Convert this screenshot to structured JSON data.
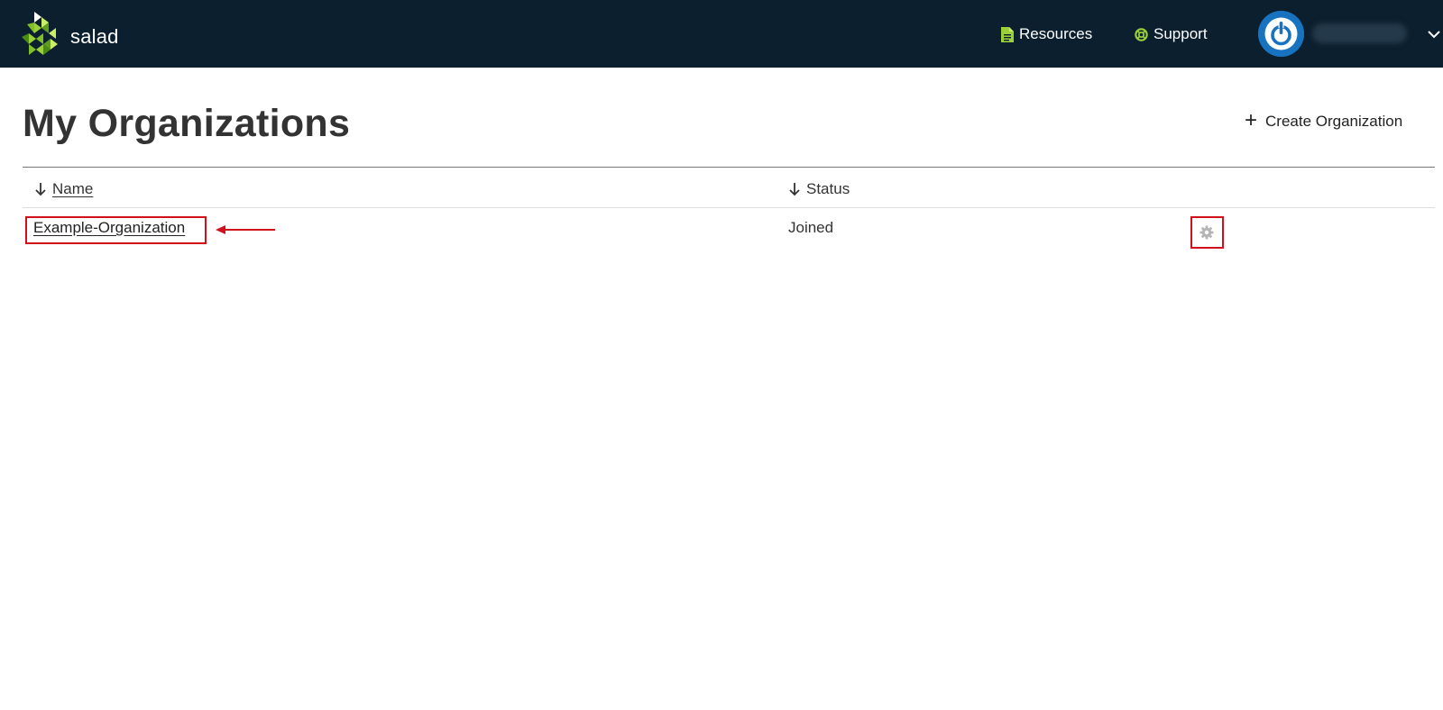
{
  "brand": {
    "name": "salad"
  },
  "nav": {
    "resources_label": "Resources",
    "support_label": "Support"
  },
  "page": {
    "title": "My Organizations",
    "create_button_label": "Create Organization"
  },
  "table": {
    "columns": [
      {
        "label": "Name",
        "sort": "descending"
      },
      {
        "label": "Status",
        "sort": "descending"
      }
    ],
    "rows": [
      {
        "name": "Example-Organization",
        "status": "Joined"
      }
    ]
  },
  "colors": {
    "topbar": "#0c1f2e",
    "accent_green": "#9bd03a",
    "avatar_blue": "#1772c0",
    "highlight_red": "#d0101a"
  }
}
